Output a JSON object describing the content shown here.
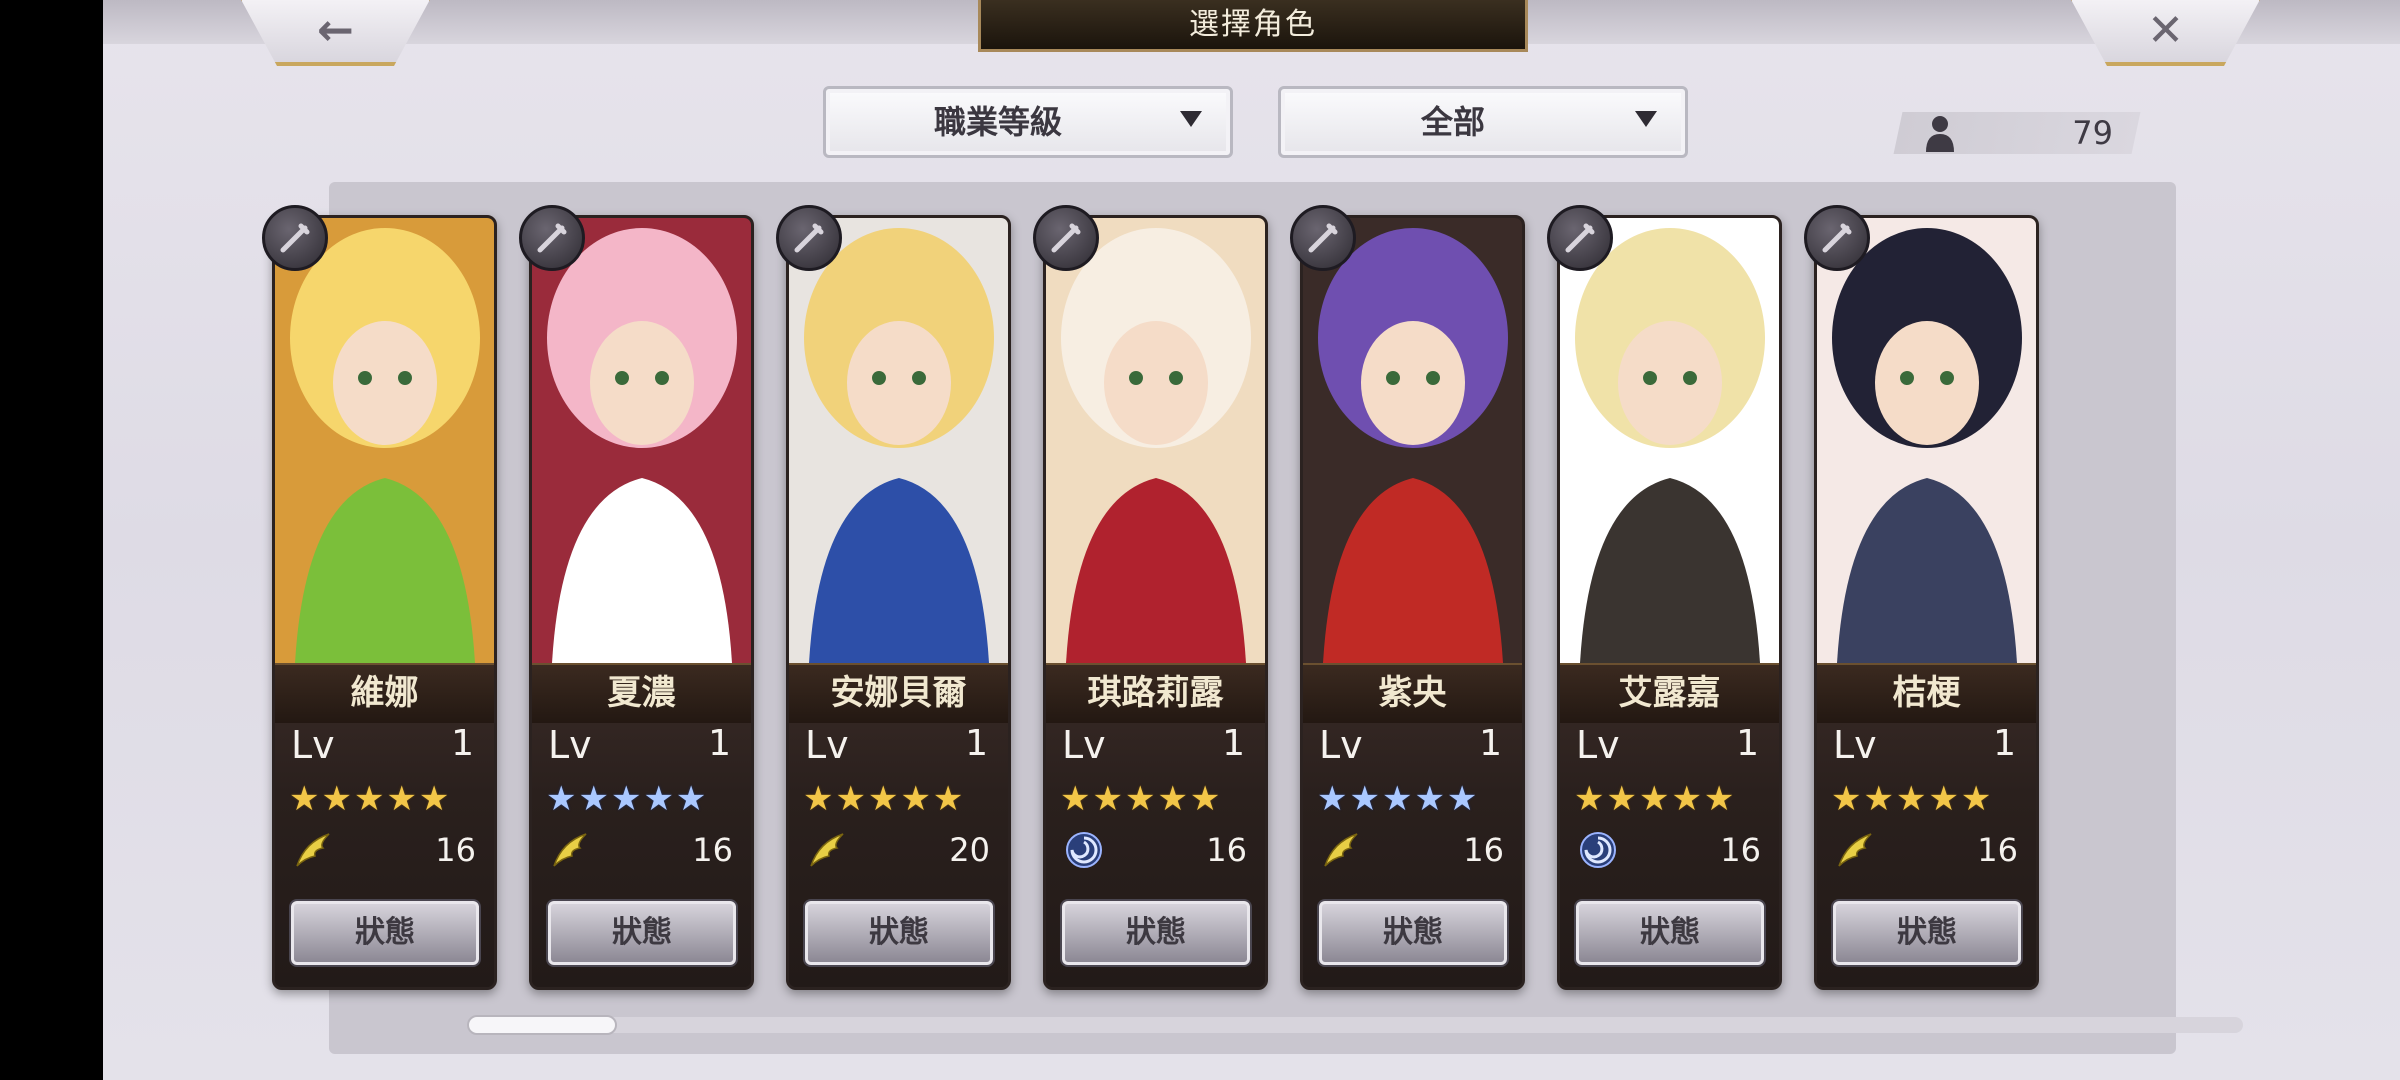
{
  "header": {
    "title": "選擇角色",
    "back_icon": "←",
    "close_icon": "✕"
  },
  "filters": {
    "sort_value": "職業等級",
    "filter_value": "全部"
  },
  "roster": {
    "count": "79"
  },
  "characters": [
    {
      "name": "維娜",
      "lv_label": "Lv",
      "level": "1",
      "stars": "★★★★★",
      "star_color": "gold",
      "element": "wing",
      "stat": "16",
      "status_label": "狀態",
      "class_icon": "staff-icon"
    },
    {
      "name": "夏濃",
      "lv_label": "Lv",
      "level": "1",
      "stars": "★★★★★",
      "star_color": "blue",
      "element": "wing",
      "stat": "16",
      "status_label": "狀態",
      "class_icon": "sword-icon"
    },
    {
      "name": "安娜貝爾",
      "lv_label": "Lv",
      "level": "1",
      "stars": "★★★★★",
      "star_color": "gold",
      "element": "wing",
      "stat": "20",
      "status_label": "狀態",
      "class_icon": "sword-icon"
    },
    {
      "name": "琪路莉露",
      "lv_label": "Lv",
      "level": "1",
      "stars": "★★★★★",
      "star_color": "gold",
      "element": "swirl",
      "stat": "16",
      "status_label": "狀態",
      "class_icon": "sword-icon"
    },
    {
      "name": "紫央",
      "lv_label": "Lv",
      "level": "1",
      "stars": "★★★★★",
      "star_color": "blue",
      "element": "wing",
      "stat": "16",
      "status_label": "狀態",
      "class_icon": "katana-icon"
    },
    {
      "name": "艾露嘉",
      "lv_label": "Lv",
      "level": "1",
      "stars": "★★★★★",
      "star_color": "gold",
      "element": "swirl",
      "stat": "16",
      "status_label": "狀態",
      "class_icon": "katana-icon"
    },
    {
      "name": "桔梗",
      "lv_label": "Lv",
      "level": "1",
      "stars": "★★★★★",
      "star_color": "gold",
      "element": "wing",
      "stat": "16",
      "status_label": "狀態",
      "class_icon": "axe-icon"
    }
  ],
  "colors": {
    "accent_gold": "#c9a75e",
    "star_gold": "#f2c648",
    "star_blue": "#aac8ff"
  },
  "scrollbar": {
    "position_fraction": 0.0
  }
}
